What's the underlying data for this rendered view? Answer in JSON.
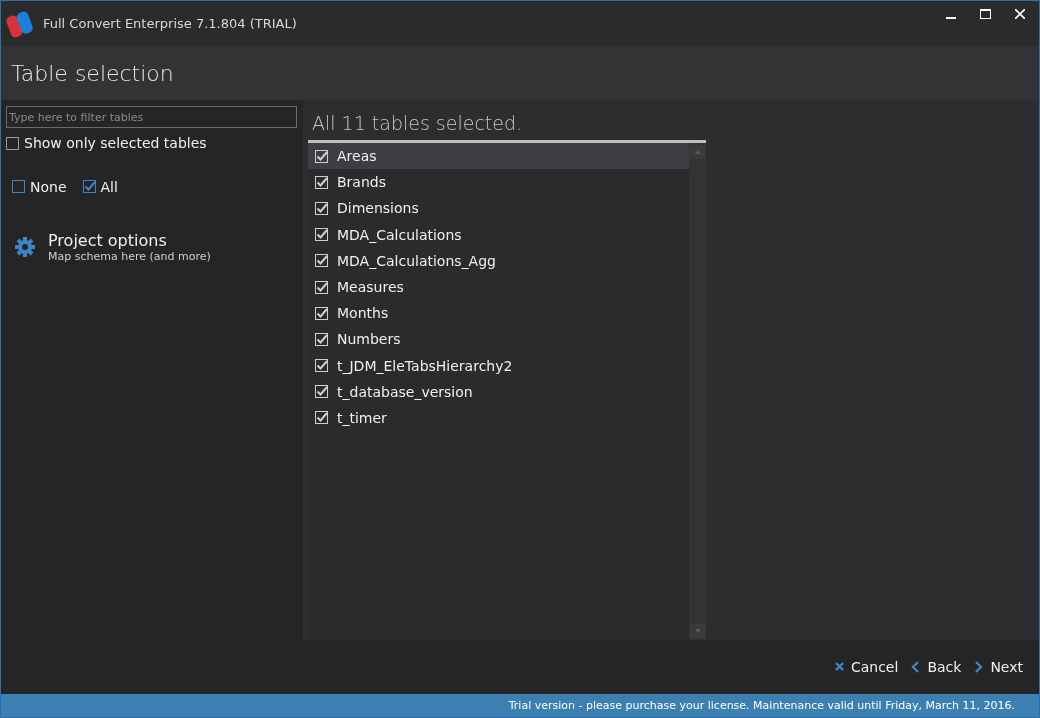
{
  "window": {
    "title": "Full Convert Enterprise 7.1.804 (TRIAL)"
  },
  "page_title": "Table selection",
  "filter": {
    "placeholder": "Type here to filter tables"
  },
  "show_only_selected": {
    "label": "Show only selected tables",
    "checked": false
  },
  "select_none": {
    "label": "None",
    "checked": false
  },
  "select_all": {
    "label": "All",
    "checked": true
  },
  "project_options": {
    "title": "Project options",
    "subtitle": "Map schema here (and more)"
  },
  "summary": "All 11 tables selected.",
  "tables": [
    {
      "name": "Areas",
      "checked": true,
      "selected": true
    },
    {
      "name": "Brands",
      "checked": true,
      "selected": false
    },
    {
      "name": "Dimensions",
      "checked": true,
      "selected": false
    },
    {
      "name": "MDA_Calculations",
      "checked": true,
      "selected": false
    },
    {
      "name": "MDA_Calculations_Agg",
      "checked": true,
      "selected": false
    },
    {
      "name": "Measures",
      "checked": true,
      "selected": false
    },
    {
      "name": "Months",
      "checked": true,
      "selected": false
    },
    {
      "name": "Numbers",
      "checked": true,
      "selected": false
    },
    {
      "name": "t_JDM_EleTabsHierarchy2",
      "checked": true,
      "selected": false
    },
    {
      "name": "t_database_version",
      "checked": true,
      "selected": false
    },
    {
      "name": "t_timer",
      "checked": true,
      "selected": false
    }
  ],
  "buttons": [
    {
      "label": "Cancel",
      "kind": "cancel"
    },
    {
      "label": "Back",
      "kind": "back"
    },
    {
      "label": "Next",
      "kind": "next"
    }
  ],
  "status_bar": "Trial version - please purchase your license. Maintenance valid until Friday, March 11, 2016."
}
